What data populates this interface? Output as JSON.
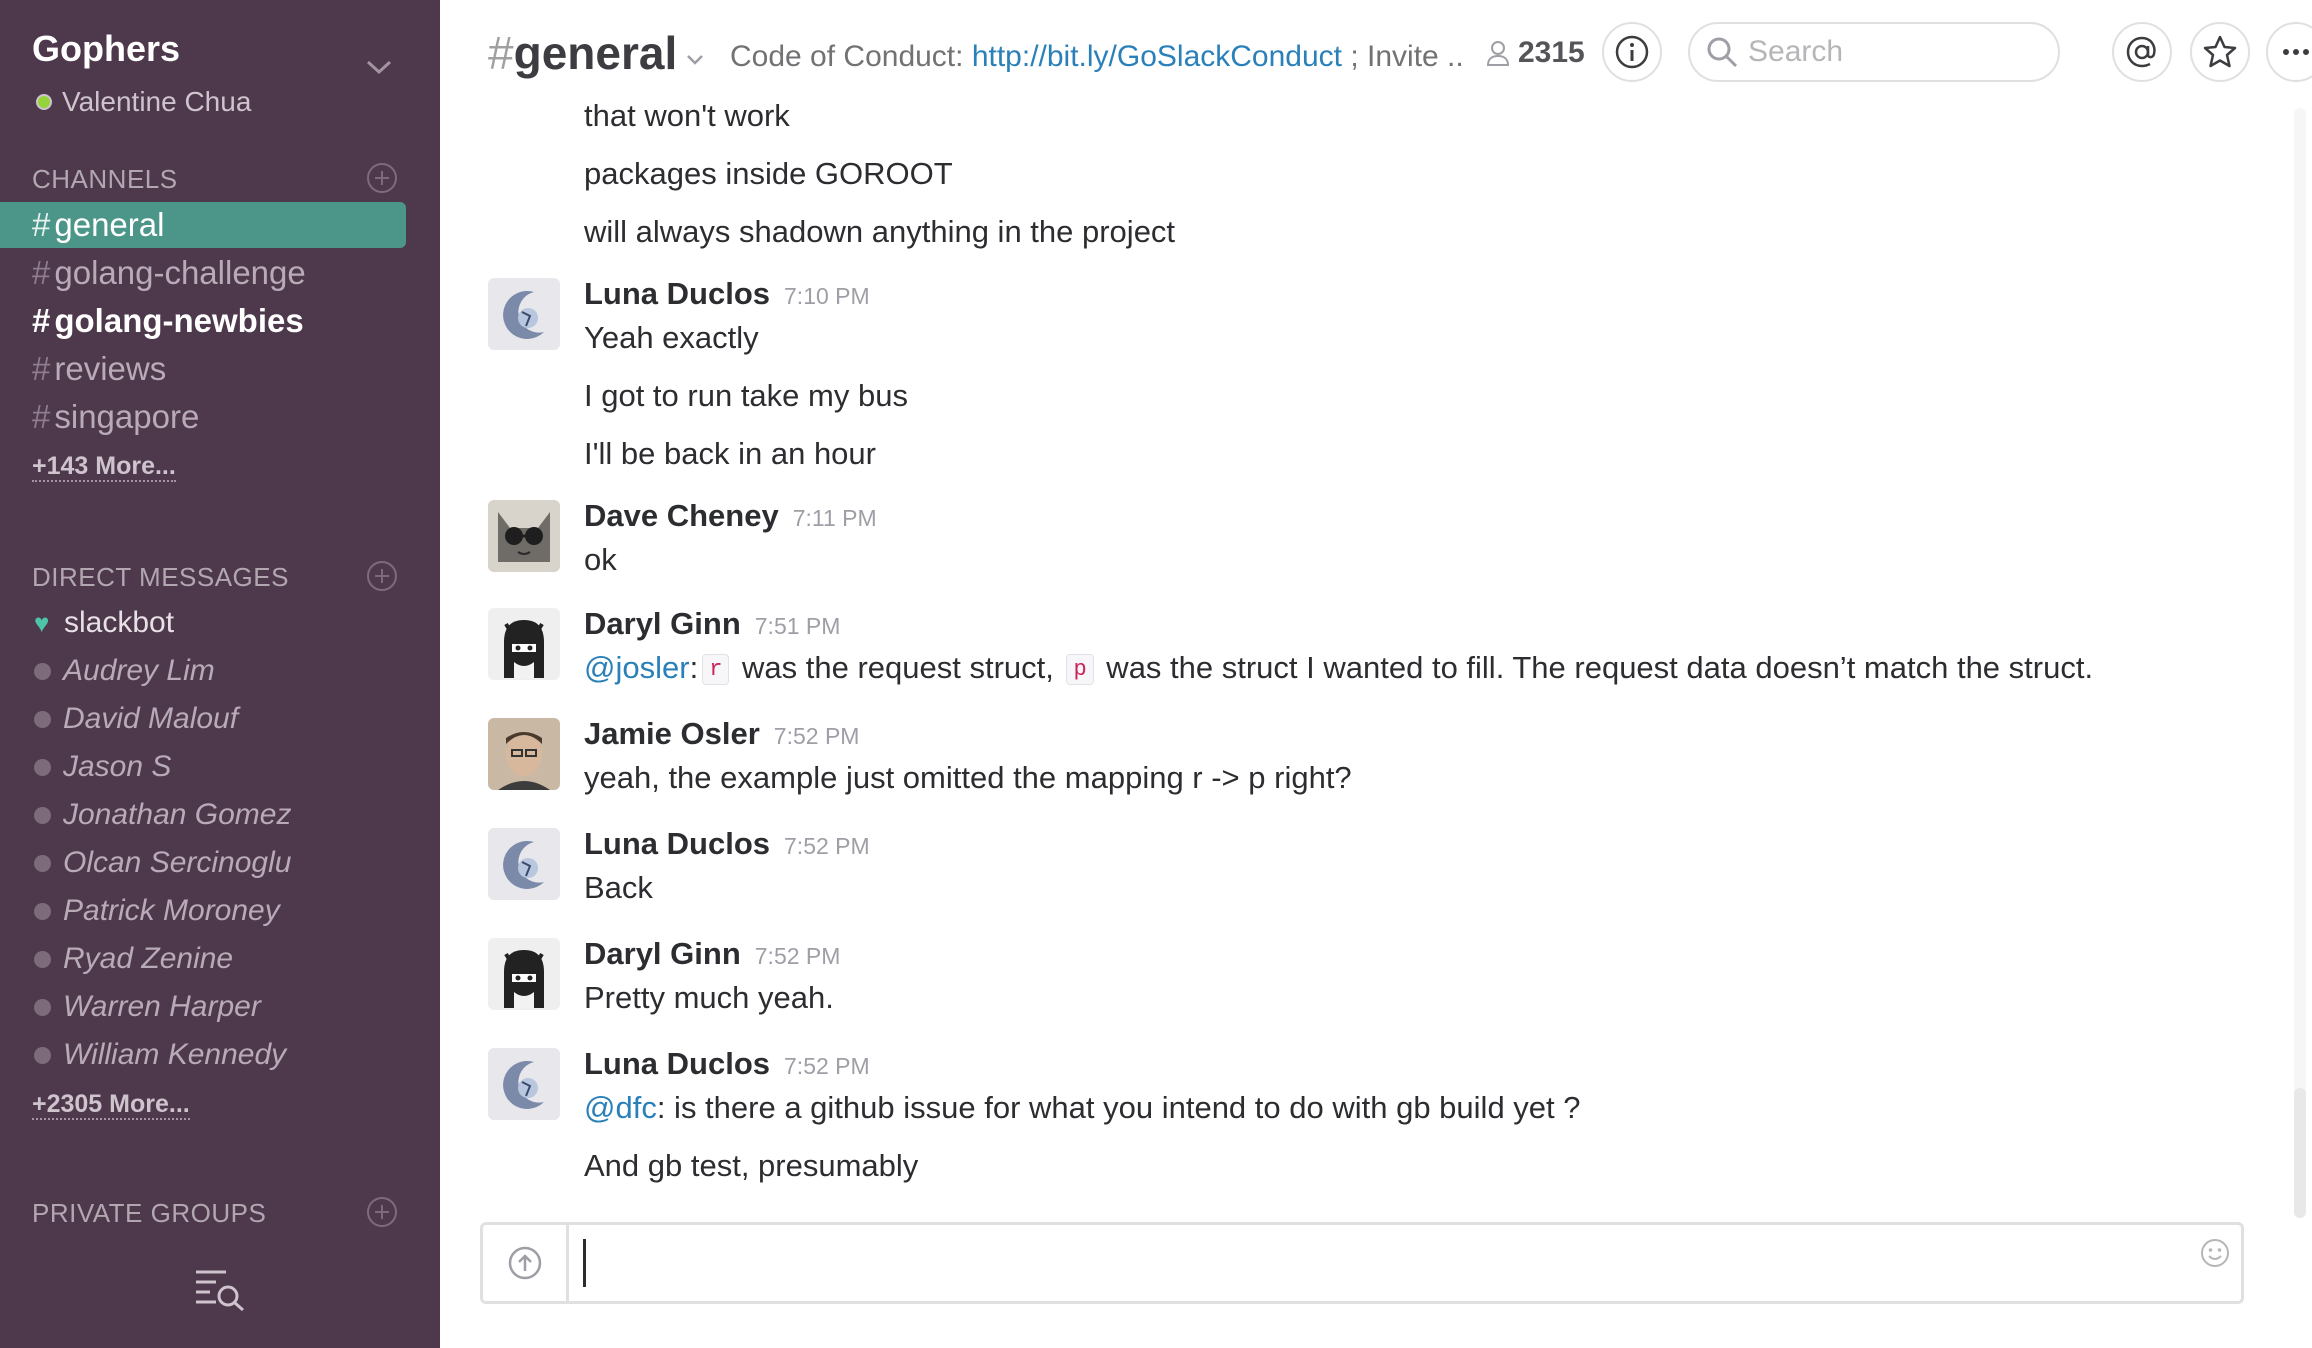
{
  "sidebar": {
    "team_name": "Gophers",
    "user_name": "Valentine Chua",
    "channels_header": "CHANNELS",
    "channels": [
      {
        "name": "general",
        "state": "active"
      },
      {
        "name": "golang-challenge",
        "state": "normal"
      },
      {
        "name": "golang-newbies",
        "state": "unread"
      },
      {
        "name": "reviews",
        "state": "normal"
      },
      {
        "name": "singapore",
        "state": "normal"
      }
    ],
    "channels_more": "+143 More...",
    "dm_header": "DIRECT MESSAGES",
    "direct_messages": [
      "slackbot",
      "Audrey Lim",
      "David Malouf",
      "Jason S",
      "Jonathan Gomez",
      "Olcan Sercinoglu",
      "Patrick Moroney",
      "Ryad Zenine",
      "Warren Harper",
      "William Kennedy"
    ],
    "dm_more": "+2305 More...",
    "groups_header": "PRIVATE GROUPS"
  },
  "header": {
    "channel_hash": "#",
    "channel_name": "general",
    "topic_prefix": "Code of Conduct: ",
    "topic_link": "http://bit.ly/GoSlackConduct",
    "topic_suffix": " ; Invite ..",
    "member_count": "2315",
    "search_placeholder": "Search"
  },
  "messages": {
    "orphan_lines": [
      "that won't work",
      "packages inside GOROOT",
      "will always shadown anything in the project"
    ],
    "groups": [
      {
        "author": "Luna Duclos",
        "time": "7:10 PM",
        "lines": [
          "Yeah exactly",
          "I got to run take my bus",
          "I'll be back in an hour"
        ]
      },
      {
        "author": "Dave Cheney",
        "time": "7:11 PM",
        "lines": [
          "ok"
        ]
      },
      {
        "author": "Daryl Ginn",
        "time": "7:51 PM",
        "mention": "@josler",
        "code_r": "r",
        "text_a": " was the request struct, ",
        "code_p": "p",
        "text_b": " was the struct I wanted to fill. The request data doesn’t match the struct."
      },
      {
        "author": "Jamie Osler",
        "time": "7:52 PM",
        "lines": [
          "yeah, the example just omitted the mapping r -> p right?"
        ]
      },
      {
        "author": "Luna Duclos",
        "time": "7:52 PM",
        "lines": [
          "Back"
        ]
      },
      {
        "author": "Daryl Ginn",
        "time": "7:52 PM",
        "lines": [
          "Pretty much yeah."
        ]
      },
      {
        "author": "Luna Duclos",
        "time": "7:52 PM",
        "mention": "@dfc",
        "text_a": ": is there a github issue for what you intend to do with gb build yet ?",
        "lines": [
          "And gb test, presumably"
        ]
      }
    ]
  },
  "colors": {
    "sidebar_bg": "#4d394b",
    "active_channel": "#4c9689",
    "link": "#2a80b9"
  }
}
